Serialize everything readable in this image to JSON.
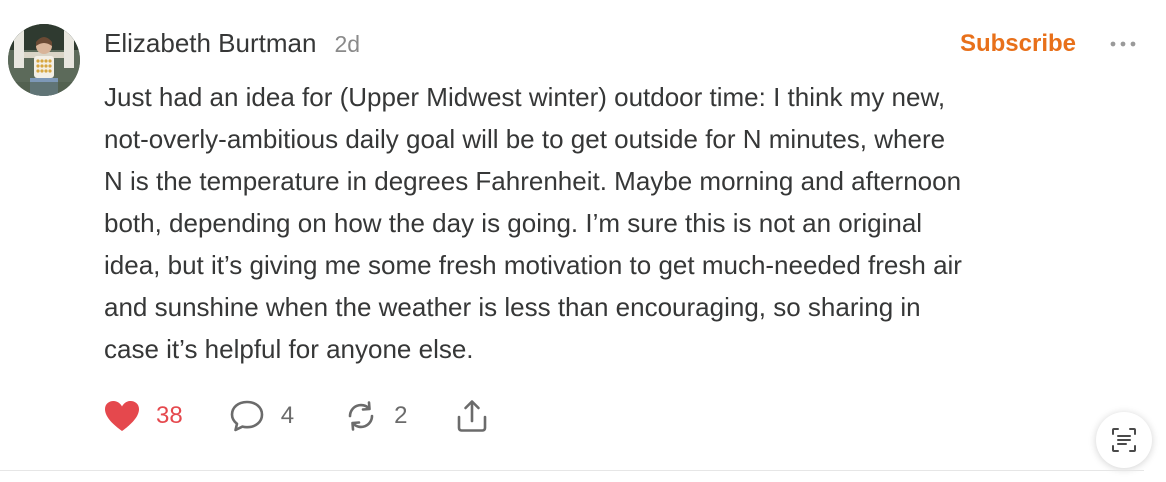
{
  "note": {
    "author": "Elizabeth Burtman",
    "timestamp": "2d",
    "subscribe_label": "Subscribe",
    "body": "Just had an idea for (Upper Midwest winter) outdoor time: I think my new,\nnot-overly-ambitious daily goal will be to get outside for N minutes, where\nN is the temperature in degrees Fahrenheit. Maybe morning and afternoon\nboth, depending on how the day is going. I’m sure this is not an original\nidea, but it’s giving me some fresh motivation to get much-needed fresh air\nand sunshine when the weather is less than encouraging, so sharing in\ncase it’s helpful for anyone else."
  },
  "actions": {
    "likes": "38",
    "comments": "4",
    "restacks": "2"
  },
  "icons": {
    "avatar": "author-avatar",
    "more": "ellipsis-icon",
    "like": "heart-icon",
    "comment": "comment-bubble-icon",
    "restack": "restack-arrows-icon",
    "share": "share-icon",
    "reader": "reader-mode-icon"
  },
  "colors": {
    "accent": "#e8701a",
    "like": "#e5484d",
    "text": "#363737",
    "muted": "#8a8a8a"
  }
}
